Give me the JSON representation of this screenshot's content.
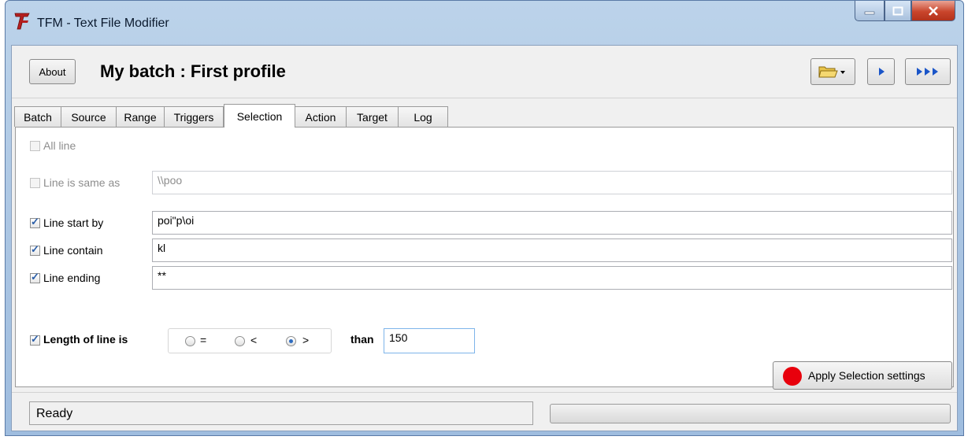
{
  "window": {
    "title": "TFM - Text File Modifier"
  },
  "header": {
    "about_label": "About",
    "batch_title": "My batch : First profile"
  },
  "tabs": [
    {
      "label": "Batch",
      "active": false
    },
    {
      "label": "Source",
      "active": false
    },
    {
      "label": "Range",
      "active": false
    },
    {
      "label": "Triggers",
      "active": false
    },
    {
      "label": "Selection",
      "active": true
    },
    {
      "label": "Action",
      "active": false
    },
    {
      "label": "Target",
      "active": false
    },
    {
      "label": "Log",
      "active": false
    }
  ],
  "selection": {
    "all_line": {
      "label": "All line",
      "checked": false,
      "enabled": false
    },
    "same_as": {
      "label": "Line is same as",
      "checked": false,
      "enabled": false,
      "value": "\\\\poo"
    },
    "start_by": {
      "label": "Line start by",
      "checked": true,
      "value": "poi\"p\\oi"
    },
    "contain": {
      "label": "Line contain",
      "checked": true,
      "value": "kl"
    },
    "ending": {
      "label": "Line ending",
      "checked": true,
      "value": "**"
    },
    "length": {
      "label": "Length of line is",
      "checked": true,
      "options": [
        "=",
        "<",
        ">"
      ],
      "selected": ">",
      "than_label": "than",
      "value": "150"
    },
    "apply_label": "Apply Selection settings"
  },
  "status": {
    "text": "Ready",
    "progress": 0
  },
  "colors": {
    "apply_dot": "#e8000c",
    "checkmark": "#2a5ea8"
  }
}
